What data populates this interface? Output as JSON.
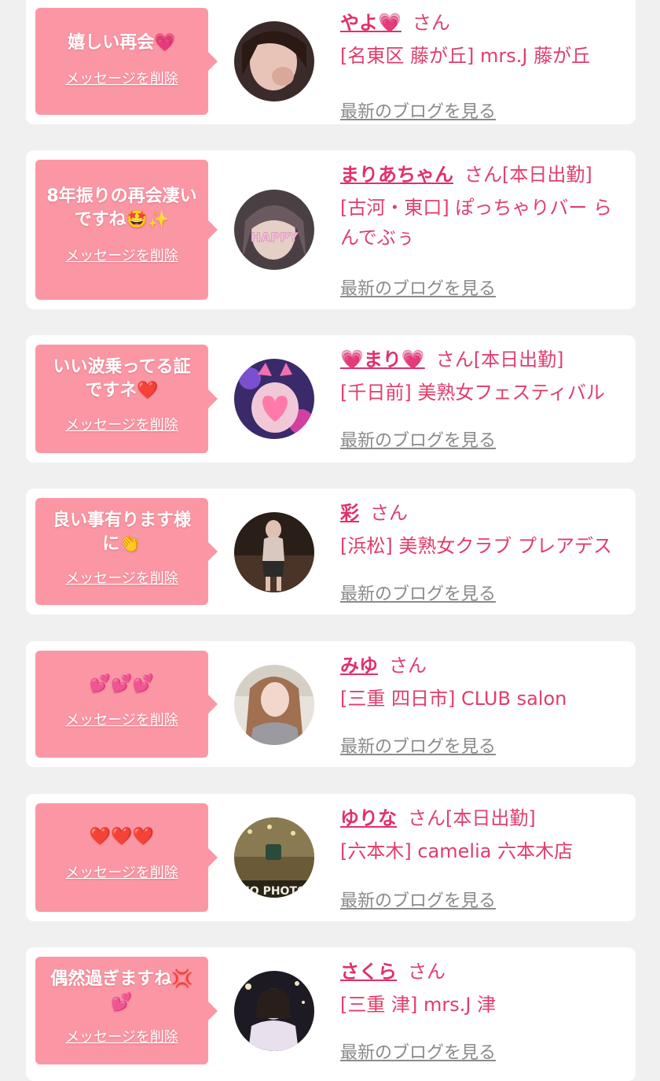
{
  "colors": {
    "page_bg": "#f0f0f0",
    "card_bg": "#ffffff",
    "bubble_bg": "#fb97a4",
    "name_color": "#e0306a",
    "text_pink": "#e04070",
    "blog_link": "#8a8a8a"
  },
  "labels": {
    "delete": "メッセージを削除",
    "san": "さん",
    "blog": "最新のブログを見る"
  },
  "entries": [
    {
      "message_line1": "嬉しい再会💗",
      "message_line2": "",
      "name": "やよ💗",
      "suffix": "",
      "shop": "[名東区 藤が丘] mrs.J 藤が丘"
    },
    {
      "message_line1": "8年振りの再会凄い",
      "message_line2": "ですね🤩✨",
      "name": "まりあちゃん",
      "suffix": "[本日出勤]",
      "shop": "[古河・東口] ぽっちゃりバー らんでぶぅ"
    },
    {
      "message_line1": "いい波乗ってる証",
      "message_line2": "ですネ❤️",
      "name": "💗まり💗",
      "suffix": "[本日出勤]",
      "shop": "[千日前] 美熟女フェスティバル"
    },
    {
      "message_line1": "良い事有ります様",
      "message_line2": "に👏",
      "name": "彩",
      "suffix": "",
      "shop": "[浜松] 美熟女クラブ プレアデス"
    },
    {
      "message_line1": "💕💕💕",
      "message_line2": "",
      "name": "みゆ",
      "suffix": "",
      "shop": "[三重 四日市] CLUB salon"
    },
    {
      "message_line1": "❤️❤️❤️",
      "message_line2": "",
      "name": "ゆりな",
      "suffix": "[本日出勤]",
      "shop": "[六本木] camelia 六本木店"
    },
    {
      "message_line1": "偶然過ぎますね💢",
      "message_line2": "💕",
      "name": "さくら",
      "suffix": "",
      "shop": "[三重 津] mrs.J 津"
    }
  ],
  "avatars": [
    "avatar-photo-yayo",
    "avatar-photo-maria",
    "avatar-photo-mari",
    "avatar-photo-aya",
    "avatar-photo-miyu",
    "avatar-photo-yurina",
    "avatar-photo-sakura"
  ]
}
